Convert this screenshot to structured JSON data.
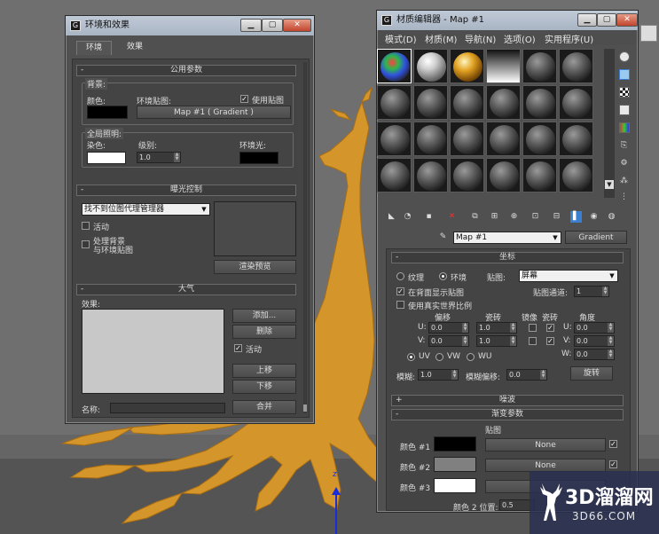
{
  "env_window": {
    "title": "环境和效果",
    "tabs": [
      "环境",
      "效果"
    ],
    "common_params": {
      "header": "公用参数",
      "background_group": "背景:",
      "color_label": "颜色:",
      "env_map_label": "环境贴图:",
      "use_map_label": "使用贴图",
      "map_button": "Map #1 ( Gradient )",
      "global_lighting_group": "全局照明:",
      "tint_label": "染色:",
      "level_label": "级别:",
      "level_value": "1.0",
      "ambient_label": "环境光:"
    },
    "exposure": {
      "header": "曝光控制",
      "dropdown_value": "找不到位图代理管理器",
      "active_label": "活动",
      "process_bg_line1": "处理背景",
      "process_bg_line2": "与环境贴图",
      "render_preview": "渲染预览"
    },
    "atmosphere": {
      "header": "大气",
      "effects_label": "效果:",
      "add": "添加...",
      "delete": "删除",
      "active_label": "活动",
      "move_up": "上移",
      "move_down": "下移",
      "name_label": "名称:",
      "merge": "合并"
    }
  },
  "mat_window": {
    "title": "材质编辑器 - Map #1",
    "menus": [
      "模式(D)",
      "材质(M)",
      "导航(N)",
      "选项(O)",
      "实用程序(U)"
    ],
    "map_name": "Map #1",
    "map_type": "Gradient",
    "coords": {
      "header": "坐标",
      "texture": "纹理",
      "environ": "环境",
      "mapping_label": "贴图:",
      "mapping_value": "屏幕",
      "show_map_back": "在背面显示贴图",
      "map_channel_label": "贴图通道:",
      "map_channel_value": "1",
      "real_world": "使用真实世界比例",
      "offset": "偏移",
      "tiling": "瓷砖",
      "mirror": "镜像",
      "tile": "瓷砖",
      "angle": "角度",
      "u_label": "U:",
      "v_label": "V:",
      "w_label": "W:",
      "u_offset": "0.0",
      "v_offset": "0.0",
      "u_tiling": "1.0",
      "v_tiling": "1.0",
      "u_angle": "0.0",
      "v_angle": "0.0",
      "w_angle": "0.0",
      "uv": "UV",
      "vw": "VW",
      "wu": "WU",
      "blur_label": "模糊:",
      "blur_value": "1.0",
      "blur_offset_label": "模糊偏移:",
      "blur_offset_value": "0.0",
      "rotate": "旋转"
    },
    "noise": {
      "header": "噪波"
    },
    "gradient": {
      "header": "渐变参数",
      "maps_label": "贴图",
      "color1": "颜色 #1",
      "color2": "颜色 #2",
      "color3": "颜色 #3",
      "none": "None",
      "color2_pos_label": "颜色 2 位置:",
      "color2_pos_value": "0.5"
    }
  },
  "viewport": {
    "axis_label": "z"
  },
  "watermark": {
    "brand": "3D溜溜网",
    "url": "3D66.COM"
  },
  "colors": {
    "title_bar": "#b4bfcd",
    "panel": "#505050",
    "dragon": "#d4952a",
    "close_button": "#c8452e"
  }
}
